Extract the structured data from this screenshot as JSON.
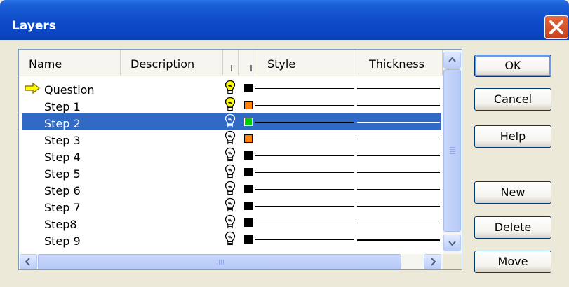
{
  "window": {
    "title": "Layers"
  },
  "list": {
    "columns": [
      "Name",
      "Description",
      "Style",
      "Thickness"
    ],
    "rows": [
      {
        "name": "Question",
        "current": true,
        "visible": true,
        "color": "#000000",
        "selected": false
      },
      {
        "name": "Step 1",
        "current": false,
        "visible": true,
        "color": "#ff8000",
        "selected": false
      },
      {
        "name": "Step 2",
        "current": false,
        "visible": false,
        "color": "#00d000",
        "selected": true
      },
      {
        "name": "Step 3",
        "current": false,
        "visible": false,
        "color": "#ff8000",
        "selected": false
      },
      {
        "name": "Step 4",
        "current": false,
        "visible": false,
        "color": "#000000",
        "selected": false
      },
      {
        "name": "Step 5",
        "current": false,
        "visible": false,
        "color": "#000000",
        "selected": false
      },
      {
        "name": "Step 6",
        "current": false,
        "visible": false,
        "color": "#000000",
        "selected": false
      },
      {
        "name": "Step 7",
        "current": false,
        "visible": false,
        "color": "#000000",
        "selected": false
      },
      {
        "name": "Step8",
        "current": false,
        "visible": false,
        "color": "#000000",
        "selected": false
      },
      {
        "name": "Step 9",
        "current": false,
        "visible": false,
        "color": "#000000",
        "selected": false
      }
    ]
  },
  "buttons": {
    "ok": "OK",
    "cancel": "Cancel",
    "help": "Help",
    "new": "New",
    "delete": "Delete",
    "move": "Move"
  },
  "colors": {
    "titlebar": "#0a45c2",
    "selection": "#316ac5",
    "bulb_on": "#ffff00",
    "close": "#d2522a"
  },
  "icons": {
    "current_layer": "arrow-right-icon",
    "visibility": "light-bulb-icon"
  }
}
